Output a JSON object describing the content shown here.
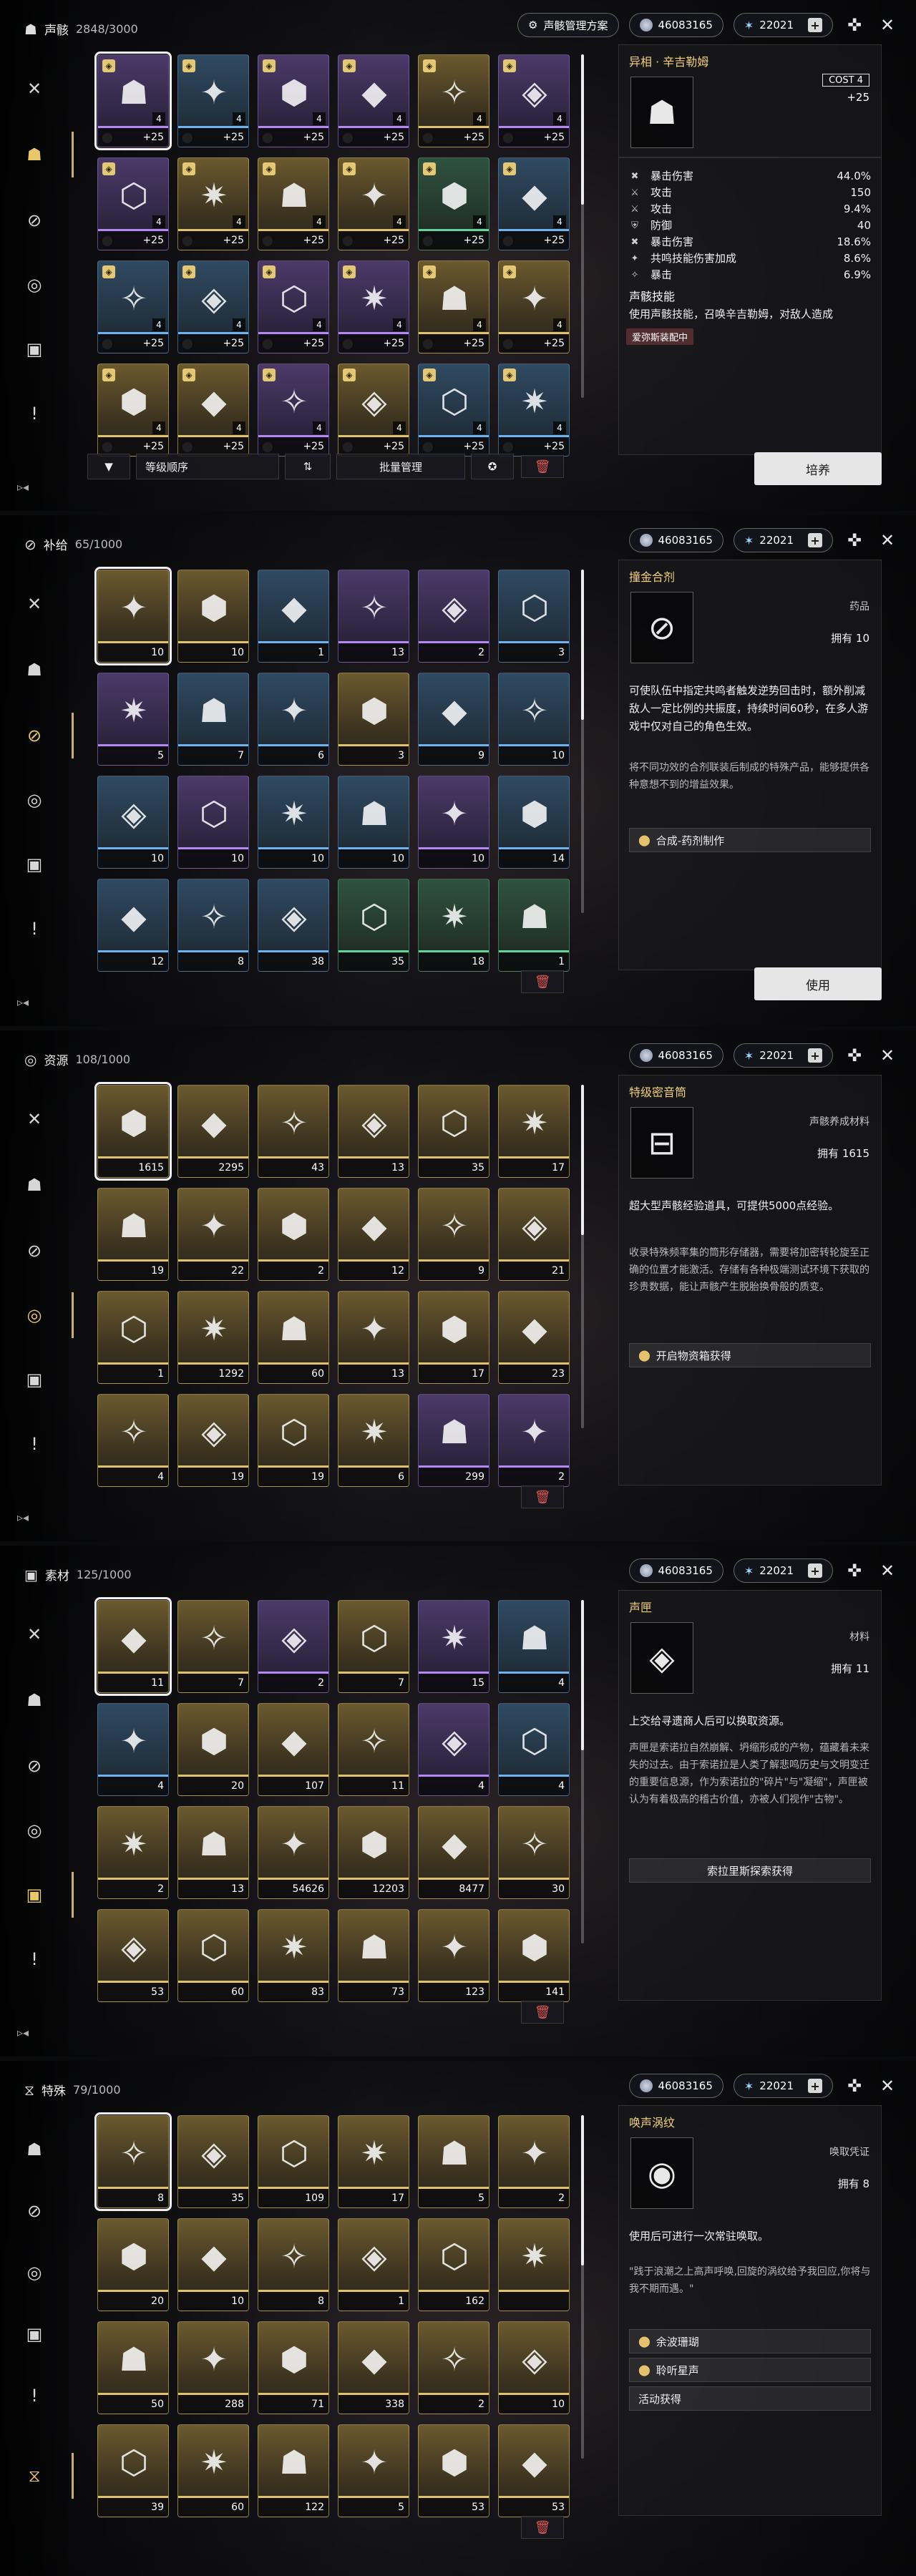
{
  "currency": {
    "coins": "46083165",
    "stars": "22021"
  },
  "sidebar_icons": [
    "swords-icon",
    "echo-mask-icon",
    "capsule-icon",
    "resource-icon",
    "material-icon",
    "special-icon"
  ],
  "panels": [
    {
      "category": "声骸",
      "count": "2848/3000",
      "scheme_label": "声骸管理方案",
      "item": {
        "name": "异相 · 辛吉勒姆",
        "cost_tag": "COST  4",
        "level": "+25",
        "stats": [
          {
            "k": "暴击伤害",
            "v": "44.0%"
          },
          {
            "k": "攻击",
            "v": "150"
          },
          {
            "k": "攻击",
            "v": "9.4%"
          },
          {
            "k": "防御",
            "v": "40"
          },
          {
            "k": "暴击伤害",
            "v": "18.6%"
          },
          {
            "k": "共鸣技能伤害加成",
            "v": "8.6%"
          },
          {
            "k": "暴击",
            "v": "6.9%"
          }
        ],
        "skill_title": "声骸技能",
        "desc": "使用声骸技能，召唤辛吉勒姆，对敌人造成",
        "equipped": "爱弥斯装配中"
      },
      "toolbar": {
        "sort": "等级顺序",
        "batch": "批量管理"
      },
      "action": "培养",
      "slots": [
        {
          "q": "purple",
          "t": "+25",
          "c": "4",
          "sel": true
        },
        {
          "q": "blue",
          "t": "+25",
          "c": "4"
        },
        {
          "q": "purple",
          "t": "+25",
          "c": "4"
        },
        {
          "q": "purple",
          "t": "+25",
          "c": "4"
        },
        {
          "q": "gold",
          "t": "+25",
          "c": "4"
        },
        {
          "q": "purple",
          "t": "+25",
          "c": "4"
        },
        {
          "q": "purple",
          "t": "+25",
          "c": "4"
        },
        {
          "q": "gold",
          "t": "+25",
          "c": "4"
        },
        {
          "q": "gold",
          "t": "+25",
          "c": "4"
        },
        {
          "q": "gold",
          "t": "+25",
          "c": "4"
        },
        {
          "q": "green",
          "t": "+25",
          "c": "4"
        },
        {
          "q": "blue",
          "t": "+25",
          "c": "4"
        },
        {
          "q": "blue",
          "t": "+25",
          "c": "4"
        },
        {
          "q": "blue",
          "t": "+25",
          "c": "4"
        },
        {
          "q": "purple",
          "t": "+25",
          "c": "4"
        },
        {
          "q": "purple",
          "t": "+25",
          "c": "4"
        },
        {
          "q": "gold",
          "t": "+25",
          "c": "4"
        },
        {
          "q": "gold",
          "t": "+25",
          "c": "4"
        },
        {
          "q": "gold",
          "t": "+25",
          "c": "4"
        },
        {
          "q": "gold",
          "t": "+25",
          "c": "4"
        },
        {
          "q": "purple",
          "t": "+25",
          "c": "4"
        },
        {
          "q": "gold",
          "t": "+25",
          "c": "4"
        },
        {
          "q": "blue",
          "t": "+25",
          "c": "4"
        },
        {
          "q": "blue",
          "t": "+25",
          "c": "4"
        }
      ]
    },
    {
      "category": "补给",
      "count": "65/1000",
      "item": {
        "name": "撞金合剂",
        "kind": "药品",
        "own": "拥有 10",
        "desc": "可使队伍中指定共鸣者触发逆势回击时，额外削减敌人一定比例的共振度，持续时间60秒，在多人游戏中仅对自己的角色生效。",
        "sub": "将不同功效的合剂联装后制成的特殊产品，能够提供各种意想不到的增益效果。",
        "source": "合成-药剂制作"
      },
      "action": "使用",
      "slots": [
        {
          "q": "gold",
          "t": "10",
          "sel": true
        },
        {
          "q": "gold",
          "t": "10"
        },
        {
          "q": "blue",
          "t": "1"
        },
        {
          "q": "purple",
          "t": "13"
        },
        {
          "q": "purple",
          "t": "2"
        },
        {
          "q": "blue",
          "t": "3"
        },
        {
          "q": "purple",
          "t": "5"
        },
        {
          "q": "blue",
          "t": "7"
        },
        {
          "q": "blue",
          "t": "6"
        },
        {
          "q": "gold",
          "t": "3"
        },
        {
          "q": "blue",
          "t": "9"
        },
        {
          "q": "blue",
          "t": "10"
        },
        {
          "q": "blue",
          "t": "10"
        },
        {
          "q": "purple",
          "t": "10"
        },
        {
          "q": "blue",
          "t": "10"
        },
        {
          "q": "blue",
          "t": "10"
        },
        {
          "q": "purple",
          "t": "10"
        },
        {
          "q": "blue",
          "t": "14"
        },
        {
          "q": "blue",
          "t": "12"
        },
        {
          "q": "blue",
          "t": "8"
        },
        {
          "q": "blue",
          "t": "38"
        },
        {
          "q": "green",
          "t": "35"
        },
        {
          "q": "green",
          "t": "18"
        },
        {
          "q": "green",
          "t": "1"
        }
      ]
    },
    {
      "category": "资源",
      "count": "108/1000",
      "item": {
        "name": "特级密音筒",
        "kind": "声骸养成材料",
        "own": "拥有 1615",
        "desc": "超大型声骸经验道具，可提供5000点经验。",
        "sub": "收录特殊频率集的筒形存储器，需要将加密转轮旋至正确的位置才能激活。存储有各种极端测试环境下获取的珍贵数据，能让声骸产生脱胎换骨般的质变。",
        "source": "开启物资箱获得"
      },
      "slots": [
        {
          "q": "gold",
          "t": "1615",
          "sel": true
        },
        {
          "q": "gold",
          "t": "2295"
        },
        {
          "q": "gold",
          "t": "43"
        },
        {
          "q": "gold",
          "t": "13"
        },
        {
          "q": "gold",
          "t": "35"
        },
        {
          "q": "gold",
          "t": "17"
        },
        {
          "q": "gold",
          "t": "19"
        },
        {
          "q": "gold",
          "t": "22"
        },
        {
          "q": "gold",
          "t": "2"
        },
        {
          "q": "gold",
          "t": "12"
        },
        {
          "q": "gold",
          "t": "9"
        },
        {
          "q": "gold",
          "t": "21"
        },
        {
          "q": "gold",
          "t": "1"
        },
        {
          "q": "gold",
          "t": "1292"
        },
        {
          "q": "gold",
          "t": "60"
        },
        {
          "q": "gold",
          "t": "13"
        },
        {
          "q": "gold",
          "t": "17"
        },
        {
          "q": "gold",
          "t": "23"
        },
        {
          "q": "gold",
          "t": "4"
        },
        {
          "q": "gold",
          "t": "19"
        },
        {
          "q": "gold",
          "t": "19"
        },
        {
          "q": "gold",
          "t": "6"
        },
        {
          "q": "purple",
          "t": "299"
        },
        {
          "q": "purple",
          "t": "2"
        }
      ]
    },
    {
      "category": "素材",
      "count": "125/1000",
      "item": {
        "name": "声匣",
        "kind": "材料",
        "own": "拥有 11",
        "desc": "上交给寻遗商人后可以换取资源。",
        "sub": "声匣是索诺拉自然崩解、坍缩形成的产物，蕴藏着未来失的过去。由于索诺拉是人类了解悲鸣历史与文明变迁的重要信息源，作为索诺拉的\"碎片\"与\"凝缩\"，声匣被认为有着极高的稽古价值，亦被人们视作\"古物\"。",
        "source": "索拉里斯探索获得"
      },
      "slots": [
        {
          "q": "gold",
          "t": "11",
          "sel": true
        },
        {
          "q": "gold",
          "t": "7"
        },
        {
          "q": "purple",
          "t": "2"
        },
        {
          "q": "gold",
          "t": "7"
        },
        {
          "q": "purple",
          "t": "15"
        },
        {
          "q": "blue",
          "t": "4"
        },
        {
          "q": "blue",
          "t": "4"
        },
        {
          "q": "gold",
          "t": "20"
        },
        {
          "q": "gold",
          "t": "107"
        },
        {
          "q": "gold",
          "t": "11"
        },
        {
          "q": "purple",
          "t": "4"
        },
        {
          "q": "blue",
          "t": "4"
        },
        {
          "q": "gold",
          "t": "2"
        },
        {
          "q": "gold",
          "t": "13"
        },
        {
          "q": "gold",
          "t": "54626"
        },
        {
          "q": "gold",
          "t": "12203"
        },
        {
          "q": "gold",
          "t": "8477"
        },
        {
          "q": "gold",
          "t": "30"
        },
        {
          "q": "gold",
          "t": "53"
        },
        {
          "q": "gold",
          "t": "60"
        },
        {
          "q": "gold",
          "t": "83"
        },
        {
          "q": "gold",
          "t": "73"
        },
        {
          "q": "gold",
          "t": "123"
        },
        {
          "q": "gold",
          "t": "141"
        }
      ]
    },
    {
      "category": "特殊",
      "count": "79/1000",
      "item": {
        "name": "唤声涡纹",
        "kind": "唤取凭证",
        "own": "拥有 8",
        "desc": "使用后可进行一次常驻唤取。",
        "sub": "\"践于浪潮之上高声呼唤,回旋的涡纹给予我回应,你将与我不期而遇。\"",
        "sources": [
          "余波珊瑚",
          "聆听星声",
          "活动获得"
        ]
      },
      "slots": [
        {
          "q": "gold",
          "t": "8",
          "sel": true
        },
        {
          "q": "gold",
          "t": "35"
        },
        {
          "q": "gold",
          "t": "109"
        },
        {
          "q": "gold",
          "t": "17"
        },
        {
          "q": "gold",
          "t": "5"
        },
        {
          "q": "gold",
          "t": "2"
        },
        {
          "q": "gold",
          "t": "20"
        },
        {
          "q": "gold",
          "t": "10"
        },
        {
          "q": "gold",
          "t": "8"
        },
        {
          "q": "gold",
          "t": "1"
        },
        {
          "q": "gold",
          "t": "162"
        },
        {
          "q": "gold",
          "t": ""
        },
        {
          "q": "gold",
          "t": "50"
        },
        {
          "q": "gold",
          "t": "288"
        },
        {
          "q": "gold",
          "t": "71"
        },
        {
          "q": "gold",
          "t": "338"
        },
        {
          "q": "gold",
          "t": "2"
        },
        {
          "q": "gold",
          "t": "10"
        },
        {
          "q": "gold",
          "t": "39"
        },
        {
          "q": "gold",
          "t": "60"
        },
        {
          "q": "gold",
          "t": "122"
        },
        {
          "q": "gold",
          "t": "5"
        },
        {
          "q": "gold",
          "t": "53"
        },
        {
          "q": "gold",
          "t": "53"
        }
      ]
    }
  ]
}
